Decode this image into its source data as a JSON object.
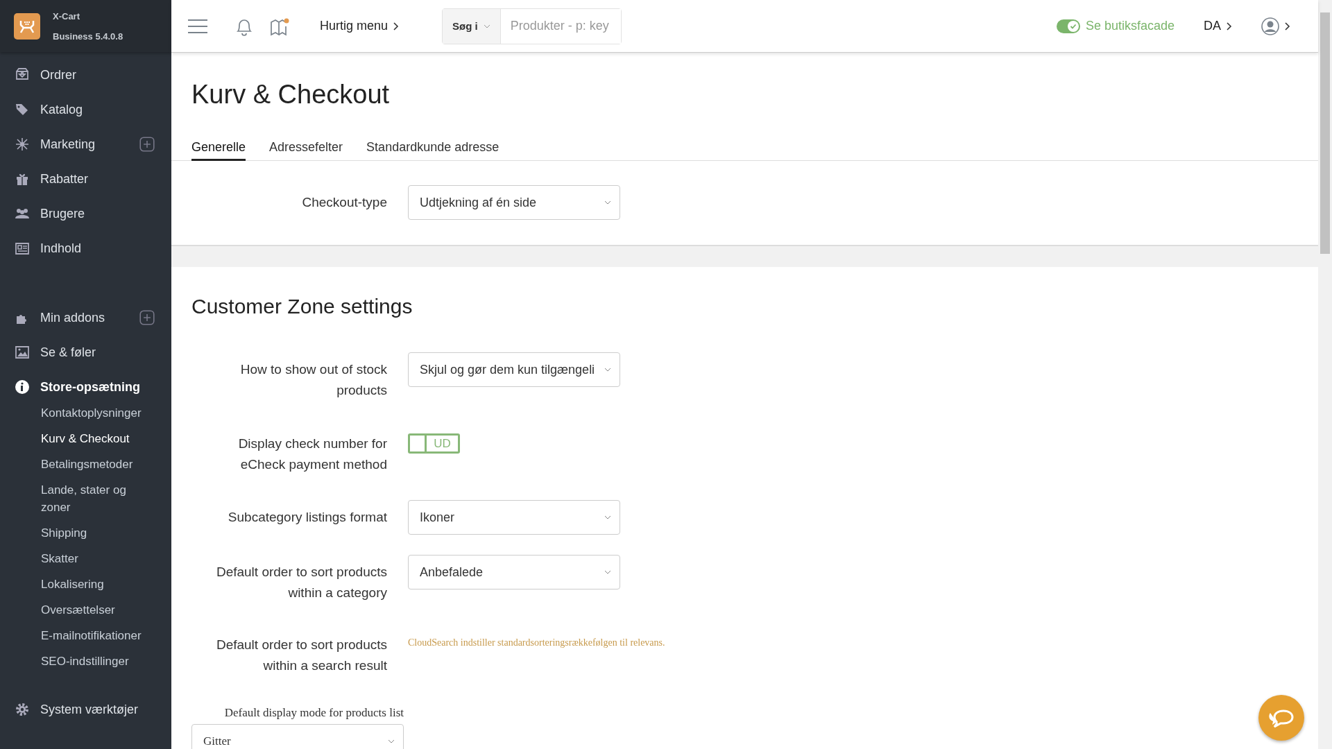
{
  "brand": {
    "name": "X-Cart",
    "edition": "Business 5.4.0.8"
  },
  "sidebar": {
    "items": [
      {
        "label": "Ordrer",
        "selected": false,
        "add_button": false
      },
      {
        "label": "Katalog",
        "selected": false,
        "add_button": false
      },
      {
        "label": "Marketing",
        "selected": false,
        "add_button": true
      },
      {
        "label": "Rabatter",
        "selected": false,
        "add_button": false
      },
      {
        "label": "Brugere",
        "selected": false,
        "add_button": false
      },
      {
        "label": "Indhold",
        "selected": false,
        "add_button": false
      },
      {
        "label": "Min addons",
        "selected": false,
        "add_button": true,
        "group_start": true
      },
      {
        "label": "Se & føler",
        "selected": false,
        "add_button": false
      },
      {
        "label": "Store-opsætning",
        "selected": true,
        "add_button": false,
        "expanded": true,
        "children": [
          {
            "label": "Kontaktoplysninger",
            "selected": false
          },
          {
            "label": "Kurv & Checkout",
            "selected": true
          },
          {
            "label": "Betalingsmetoder",
            "selected": false
          },
          {
            "label": "Lande, stater og zoner",
            "selected": false
          },
          {
            "label": "Shipping",
            "selected": false
          },
          {
            "label": "Skatter",
            "selected": false
          },
          {
            "label": "Lokalisering",
            "selected": false
          },
          {
            "label": "Oversættelser",
            "selected": false
          },
          {
            "label": "E-mailnotifikationer",
            "selected": false
          },
          {
            "label": "SEO-indstillinger",
            "selected": false
          }
        ]
      },
      {
        "label": "System værktøjer",
        "selected": false,
        "add_button": false
      }
    ]
  },
  "topbar": {
    "quick_menu": "Hurtig menu",
    "search_scope": "Søg i",
    "search": {
      "placeholder": "Produkter - p: key"
    },
    "storefront": {
      "label": "Se butiksfacade",
      "on": true
    },
    "language": "DA"
  },
  "page": {
    "title": "Kurv & Checkout",
    "tabs": [
      {
        "label": "Generelle",
        "selected": true
      },
      {
        "label": "Adressefelter",
        "selected": false
      },
      {
        "label": "Standardkunde adresse",
        "selected": false
      }
    ],
    "general_rows": [
      {
        "kind": "select",
        "label": "Checkout-type",
        "value": "Udtjekning af én side"
      }
    ],
    "section_title": "Customer Zone settings",
    "rows": [
      {
        "kind": "select",
        "label": "How to show out of stock products",
        "value": "Skjul og gør dem kun tilgængeli"
      },
      {
        "kind": "toggle",
        "label": "Display check number for eCheck payment method",
        "on": false,
        "value": "UD"
      },
      {
        "kind": "select",
        "label": "Subcategory listings format",
        "value": "Ikoner"
      },
      {
        "kind": "select",
        "label": "Default order to sort products within a category",
        "value": "Anbefalede"
      },
      {
        "kind": "note",
        "label": "Default order to sort products within a search result",
        "value": "CloudSearch indstiller standardsorteringsrækkefølgen til relevans."
      },
      {
        "kind": "stacked-select",
        "label": "Default display mode for products list",
        "value": "Gitter"
      }
    ]
  }
}
